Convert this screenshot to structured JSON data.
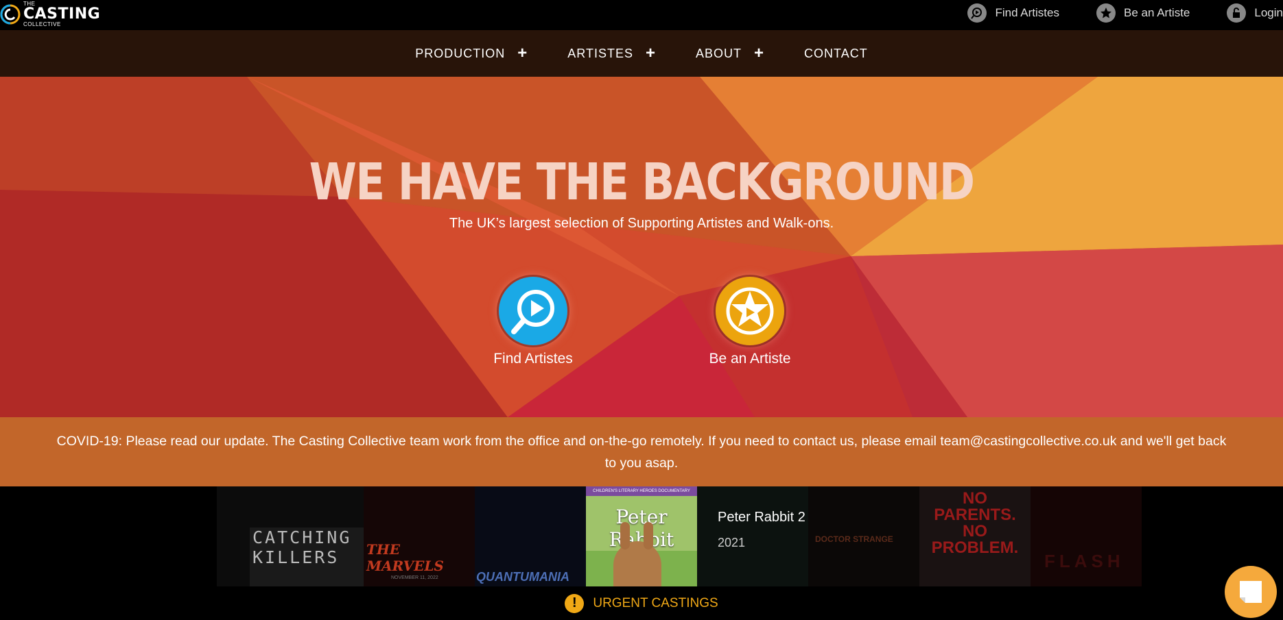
{
  "logo": {
    "small": "THE",
    "big": "CASTING",
    "sub": "COLLECTIVE"
  },
  "toplinks": [
    {
      "label": "Find Artistes",
      "icon": "play-search-icon"
    },
    {
      "label": "Be an Artiste",
      "icon": "star-icon"
    },
    {
      "label": "Login",
      "icon": "lock-icon"
    }
  ],
  "nav": [
    {
      "label": "PRODUCTION",
      "plus": "+"
    },
    {
      "label": "ARTISTES",
      "plus": "+"
    },
    {
      "label": "ABOUT",
      "plus": "+"
    },
    {
      "label": "CONTACT"
    }
  ],
  "hero": {
    "title": "WE HAVE THE BACKGROUND",
    "subtitle": "The UK’s largest selection of Supporting Artistes and Walk-ons.",
    "cta_find": "Find Artistes",
    "cta_be": "Be an Artiste"
  },
  "covid": {
    "text": "COVID-19: Please read our update. The Casting Collective team work from the office and on-the-go remotely. If you need to contact us, please email team@castingcollective.co.uk and we'll get back to you asap."
  },
  "films": {
    "posters": [
      {
        "text": "CATCHING KILLERS"
      },
      {
        "text": "THE MARVELS",
        "date": "NOVEMBER 11, 2022"
      },
      {
        "text": "QUANTUMANIA"
      },
      {
        "text": "Peter Rabbit",
        "banner": "CHILDREN'S LITERARY HEROES DOCUMENTARY SERIES"
      },
      {
        "text": ""
      },
      {
        "text": "DOCTOR STRANGE"
      },
      {
        "text": "NO PARENTS. NO PROBLEM."
      },
      {
        "text": "FLASH"
      }
    ],
    "featured_title": "Peter Rabbit 2",
    "featured_year": "2021"
  },
  "urgent": {
    "label": "URGENT CASTINGS",
    "icon_text": "!"
  },
  "colors": {
    "accent": "#f0a816",
    "blue": "#1aa9e6",
    "hero_base": "#c84a2a",
    "covid": "#c2662a"
  }
}
